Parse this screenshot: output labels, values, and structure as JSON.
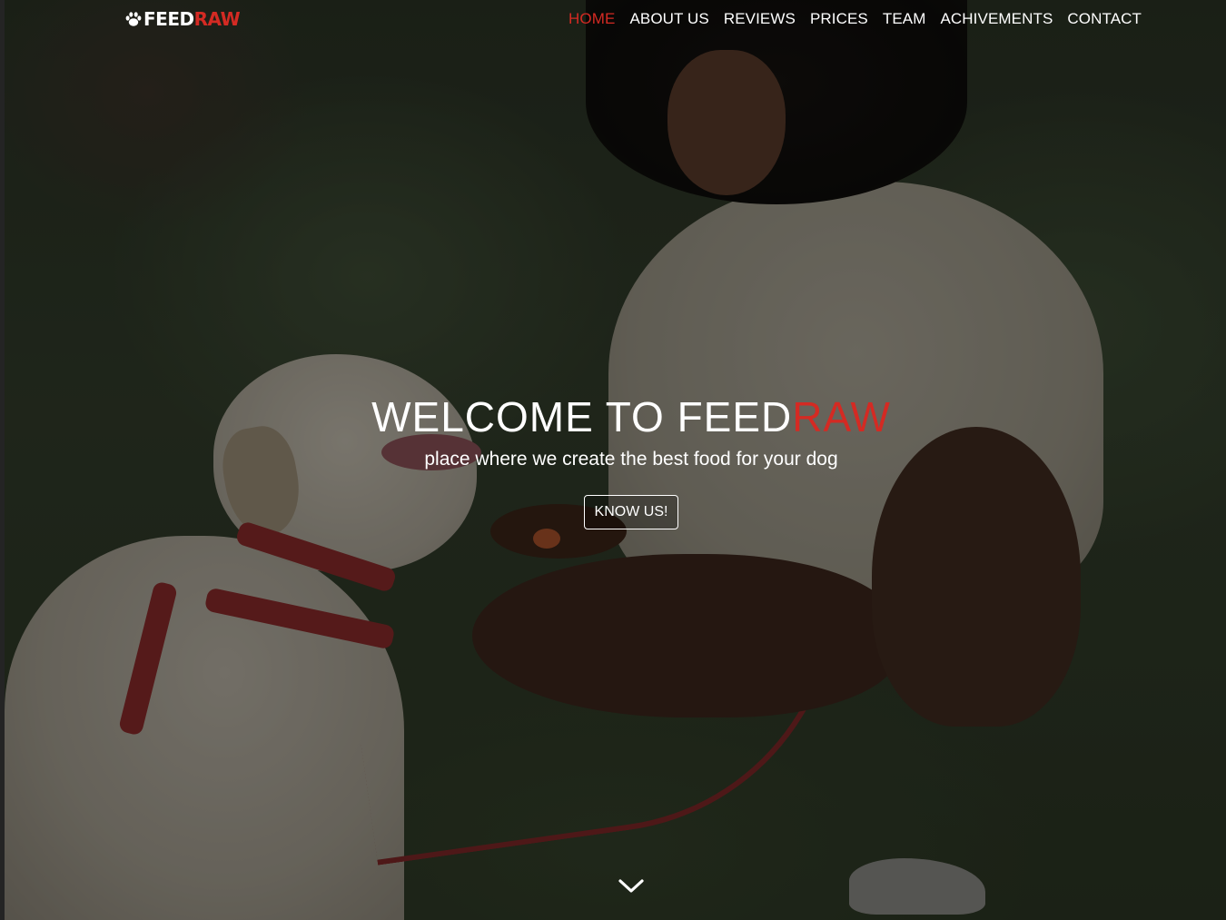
{
  "brand": {
    "name_part1": "FEED",
    "name_part2": "RAW",
    "icon": "paw-icon"
  },
  "nav": {
    "items": [
      {
        "label": "HOME",
        "active": true
      },
      {
        "label": "ABOUT US",
        "active": false
      },
      {
        "label": "REVIEWS",
        "active": false
      },
      {
        "label": "PRICES",
        "active": false
      },
      {
        "label": "TEAM",
        "active": false
      },
      {
        "label": "ACHIVEMENTS",
        "active": false
      },
      {
        "label": "CONTACT",
        "active": false
      }
    ]
  },
  "hero": {
    "title_part1": "WELCOME TO FEED",
    "title_part2": "RAW",
    "subtitle": "place where we create the best food for your dog",
    "cta_label": "KNOW US!",
    "scroll_icon": "chevron-down-icon"
  },
  "colors": {
    "accent": "#d42a23",
    "text": "#ffffff"
  }
}
